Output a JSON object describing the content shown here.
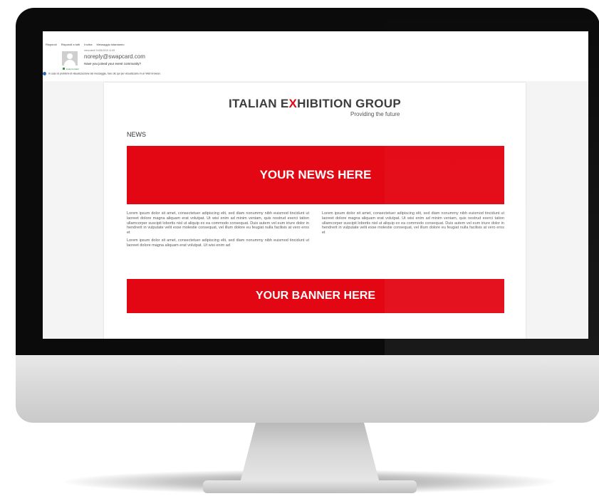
{
  "toolbar": {
    "reply": "Rispondi",
    "reply_all": "Rispondi a tutti",
    "forward": "Inoltra",
    "im": "Messaggio istantaneo"
  },
  "email": {
    "date": "mercoledì 01/05/2019 11:59",
    "from": "noreply@swapcard.com",
    "subject": "Have you joined your event community?",
    "tag": "Lista Contatti",
    "info": "In caso di problemi di visualizzazione del messaggio, fare clic qui per visualizzarlo in un Web browser."
  },
  "newsletter": {
    "logo_pre": "ITALIAN E",
    "logo_x": "X",
    "logo_post": "HIBITION GROUP",
    "tagline": "Providing the future",
    "news_label": "NEWS",
    "news_banner": "YOUR NEWS HERE",
    "left_p1": "Lorem ipsum dolor sit amet, consectetuer adipiscing elit, sed diam nonummy nibh euismod tincidunt ut laoreet dolore magna aliquam erat volutpat. Ut wisi enim ad minim veniam, quis nostrud exerci tation ullamcorper suscipit lobortis nisl ut aliquip ex ea commodo consequat. Duis autem vel eum iriure dolor in hendrerit in vulputate velit esse molestie consequat, vel illum dolore eu feugiat nulla facilisis at vero eros et",
    "left_p2": "Lorem ipsum dolor sit amet, consectetuer adipiscing elit, sed diam nonummy nibh euismod tincidunt ut laoreet dolore magna aliquam erat volutpat. Ut wisi enim ad",
    "right_p1": "Lorem ipsum dolor sit amet, consectetuer adipiscing elit, sed diam nonummy nibh euismod tincidunt ut laoreet dolore magna aliquam erat volutpat. Ut wisi enim ad minim veniam, quis nostrud exerci tation ullamcorper suscipit lobortis nisl ut aliquip ex ea commodo consequat. Duis autem vel eum iriure dolor in hendrerit in vulputate velit esse molestie consequat, vel illum dolore eu feugiat nulla facilisis at vero eros et",
    "banner": "YOUR BANNER HERE"
  },
  "colors": {
    "brand_red": "#e30613",
    "bezel": "#0b0b0b"
  }
}
